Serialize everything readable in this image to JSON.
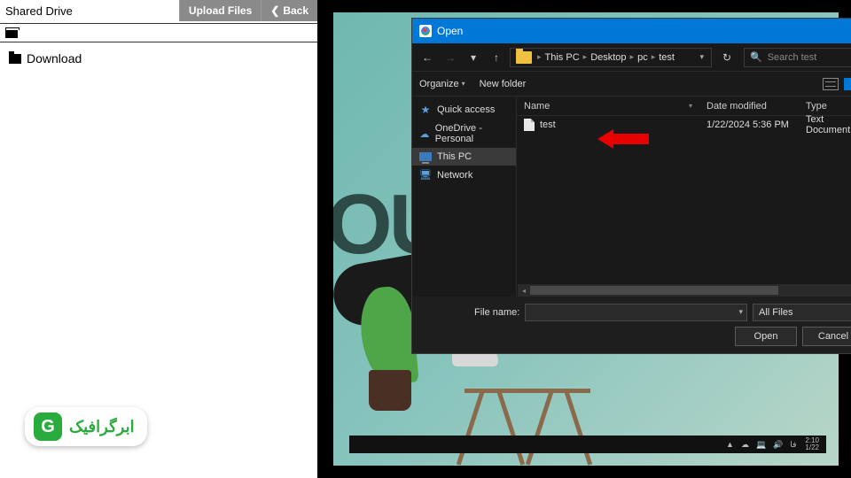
{
  "leftPanel": {
    "title": "Shared Drive",
    "uploadBtn": "Upload Files",
    "backBtn": "Back",
    "tree": {
      "download": "Download"
    }
  },
  "watermark": {
    "text": "ابرگرافیک",
    "iconLetter": "G"
  },
  "desktop": {
    "bgWord": "OU"
  },
  "taskbar": {
    "lang": "فا",
    "time": "2:10",
    "date": "1/22"
  },
  "dialog": {
    "title": "Open",
    "breadcrumbs": {
      "thisPC": "This PC",
      "desktop": "Desktop",
      "pc": "pc",
      "test": "test"
    },
    "searchPlaceholder": "Search test",
    "toolbar": {
      "organize": "Organize",
      "newFolder": "New folder"
    },
    "sidebar": {
      "quickAccess": "Quick access",
      "oneDrive": "OneDrive - Personal",
      "thisPC": "This PC",
      "network": "Network"
    },
    "columns": {
      "name": "Name",
      "date": "Date modified",
      "type": "Type"
    },
    "files": [
      {
        "name": "test",
        "date": "1/22/2024 5:36 PM",
        "type": "Text Document"
      }
    ],
    "fileNameLabel": "File name:",
    "filter": "All Files",
    "openBtn": "Open",
    "cancelBtn": "Cancel"
  }
}
